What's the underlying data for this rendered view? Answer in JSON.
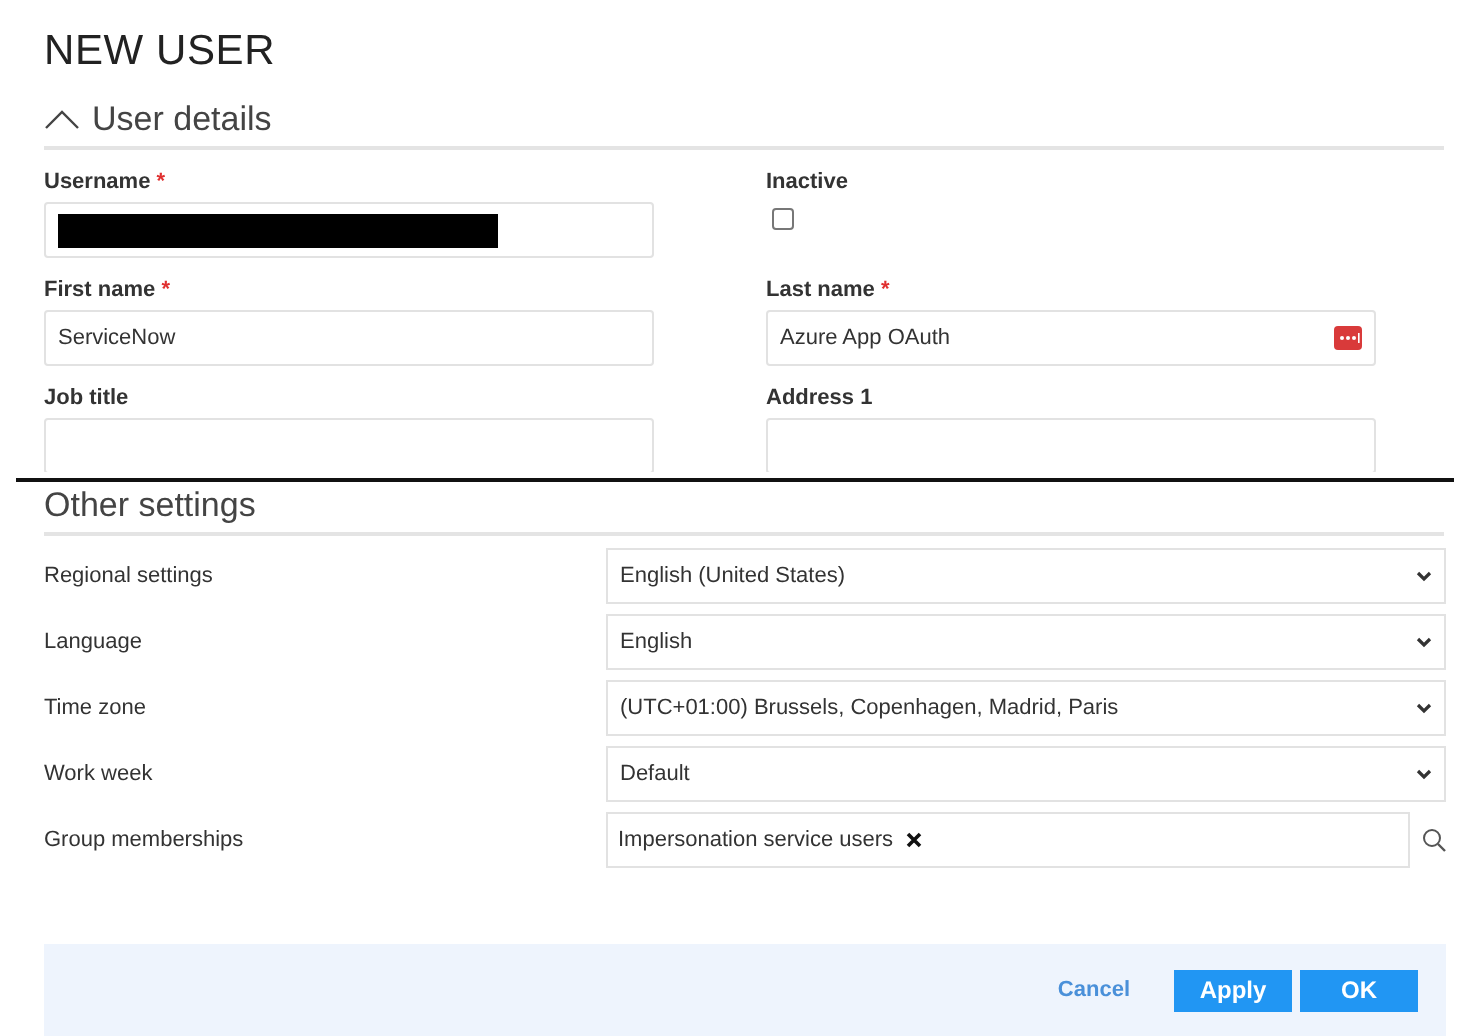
{
  "title": "NEW USER",
  "user_details": {
    "heading": "User details",
    "expanded": true,
    "fields": [
      {
        "kind": "text",
        "label": "Username",
        "required_mark": "*",
        "redacted": true
      },
      {
        "kind": "checkbox",
        "label": "Inactive",
        "checked": false
      },
      {
        "kind": "text",
        "label": "First name",
        "required_mark": "*",
        "value": "ServiceNow"
      },
      {
        "kind": "text",
        "label": "Last name",
        "required_mark": "*",
        "value": "Azure App OAuth",
        "password_icon": true
      },
      {
        "kind": "text",
        "label": "Job title"
      },
      {
        "kind": "text",
        "label": "Address 1"
      }
    ]
  },
  "other_settings": {
    "heading": "Other settings",
    "rows": [
      {
        "kind": "select",
        "label": "Regional settings",
        "value": "English (United States)"
      },
      {
        "kind": "select",
        "label": "Language",
        "value": "English"
      },
      {
        "kind": "select",
        "label": "Time zone",
        "value": "(UTC+01:00) Brussels, Copenhagen, Madrid, Paris"
      },
      {
        "kind": "select",
        "label": "Work week",
        "value": "Default"
      },
      {
        "kind": "tags",
        "label": "Group memberships",
        "tags": [
          "Impersonation service users"
        ]
      }
    ]
  },
  "footer": {
    "buttons": [
      {
        "label": "Cancel",
        "kind": "link"
      },
      {
        "label": "Apply",
        "kind": "primary"
      },
      {
        "label": "OK",
        "kind": "primary"
      }
    ]
  }
}
